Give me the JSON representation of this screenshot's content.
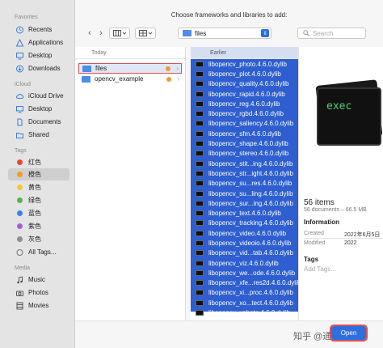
{
  "window_title": "Choose frameworks and libraries to add:",
  "sidebar": {
    "favorites_label": "Favorites",
    "favorites": [
      {
        "label": "Recents",
        "icon": "clock-icon"
      },
      {
        "label": "Applications",
        "icon": "applications-icon"
      },
      {
        "label": "Desktop",
        "icon": "desktop-icon"
      },
      {
        "label": "Downloads",
        "icon": "downloads-icon"
      }
    ],
    "icloud_label": "iCloud",
    "icloud": [
      {
        "label": "iCloud Drive",
        "icon": "cloud-icon"
      },
      {
        "label": "Desktop",
        "icon": "desktop-icon"
      },
      {
        "label": "Documents",
        "icon": "document-icon"
      },
      {
        "label": "Shared",
        "icon": "shared-folder-icon"
      }
    ],
    "tags_label": "Tags",
    "tags": [
      {
        "label": "红色",
        "color": "#e8443a"
      },
      {
        "label": "橙色",
        "color": "#f39a2c"
      },
      {
        "label": "黄色",
        "color": "#f5c834"
      },
      {
        "label": "绿色",
        "color": "#4fb74b"
      },
      {
        "label": "蓝色",
        "color": "#3b82f0"
      },
      {
        "label": "紫色",
        "color": "#a560d8"
      },
      {
        "label": "灰色",
        "color": "#8e8e93"
      },
      {
        "label": "All Tags...",
        "color": ""
      }
    ],
    "media_label": "Media",
    "media": [
      {
        "label": "Music",
        "icon": "music-icon"
      },
      {
        "label": "Photos",
        "icon": "camera-icon"
      },
      {
        "label": "Movies",
        "icon": "film-icon"
      }
    ]
  },
  "toolbar": {
    "back": "‹",
    "forward": "›",
    "location": "files",
    "search_placeholder": "Search"
  },
  "column1": {
    "header": "Today",
    "items": [
      {
        "label": "files",
        "selected": true
      },
      {
        "label": "opencv_example",
        "selected": false
      }
    ]
  },
  "column2": {
    "header": "Earlier",
    "items": [
      "libopencv_photo.4.6.0.dylib",
      "libopencv_plot.4.6.0.dylib",
      "libopencv_quality.4.6.0.dylib",
      "libopencv_rapid.4.6.0.dylib",
      "libopencv_reg.4.6.0.dylib",
      "libopencv_rgbd.4.6.0.dylib",
      "libopencv_saliency.4.6.0.dylib",
      "libopencv_sfm.4.6.0.dylib",
      "libopencv_shape.4.6.0.dylib",
      "libopencv_stereo.4.6.0.dylib",
      "libopencv_stit...ing.4.6.0.dylib",
      "libopencv_str...ight.4.6.0.dylib",
      "libopencv_su...res.4.6.0.dylib",
      "libopencv_su...ling.4.6.0.dylib",
      "libopencv_sur...ing.4.6.0.dylib",
      "libopencv_text.4.6.0.dylib",
      "libopencv_tracking.4.6.0.dylib",
      "libopencv_video.4.6.0.dylib",
      "libopencv_videoio.4.6.0.dylib",
      "libopencv_vid...tab.4.6.0.dylib",
      "libopencv_viz.4.6.0.dylib",
      "libopencv_we...ode.4.6.0.dylib",
      "libopencv_xfe...res2d.4.6.0.dylib",
      "libopencv_xi...proc.4.6.0.dylib",
      "libopencv_xo...tect.4.6.0.dylib",
      "libopencv_xphoto.4.6.0.dylib"
    ]
  },
  "preview": {
    "thumb_text": "exec",
    "count_title": "56 items",
    "count_sub": "56 documents – 66.5 MB",
    "information_label": "Information",
    "created_label": "Created",
    "created_value": "2022年6月5日",
    "modified_label": "Modified",
    "modified_value": "2022",
    "tags_label": "Tags",
    "add_tags": "Add Tags..."
  },
  "bottom": {
    "watermark": "知乎 @通阳丘湾",
    "open_label": "Open"
  }
}
